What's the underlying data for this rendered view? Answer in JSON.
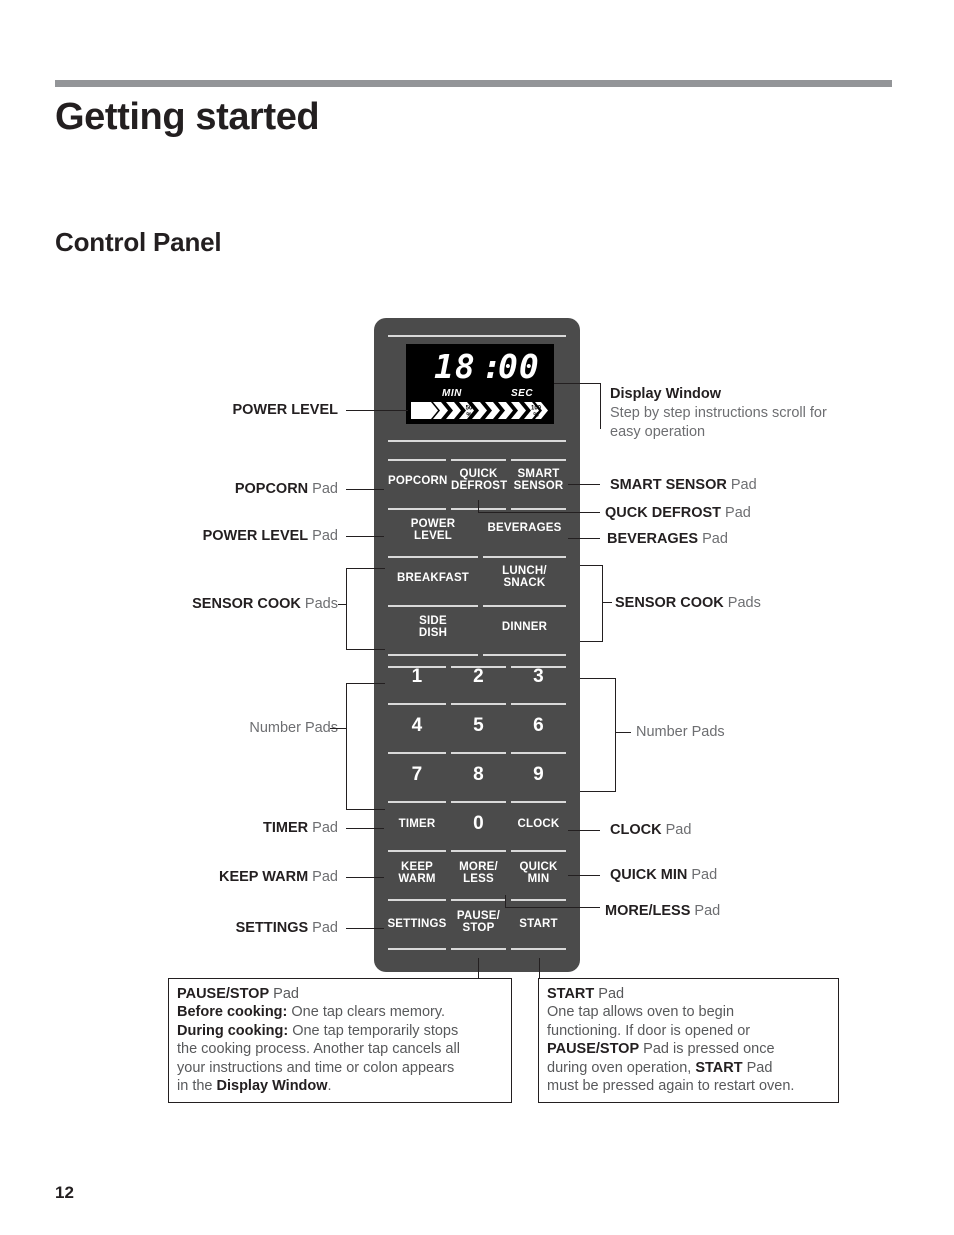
{
  "document": {
    "chapter_title": "Getting started",
    "section_title": "Control Panel",
    "page_number": "12"
  },
  "control_panel": {
    "display": {
      "minutes": "18",
      "colon": ":",
      "seconds": "00",
      "min_unit": "MIN",
      "sec_unit": "SEC",
      "bar_mark_mid": "50",
      "bar_mark_mid_pct": "%",
      "bar_mark_end": "100",
      "bar_mark_end_pct": "%"
    },
    "pads": [
      {
        "id": "popcorn",
        "line1": "POPCORN",
        "line2": ""
      },
      {
        "id": "quick-defrost",
        "line1": "QUICK",
        "line2": "DEFROST"
      },
      {
        "id": "smart-sensor",
        "line1": "SMART",
        "line2": "SENSOR"
      },
      {
        "id": "power-level",
        "line1": "POWER",
        "line2": "LEVEL"
      },
      {
        "id": "beverages",
        "line1": "BEVERAGES",
        "line2": ""
      },
      {
        "id": "breakfast",
        "line1": "BREAKFAST",
        "line2": ""
      },
      {
        "id": "lunch-snack",
        "line1": "LUNCH/",
        "line2": "SNACK"
      },
      {
        "id": "side-dish",
        "line1": "SIDE",
        "line2": "DISH"
      },
      {
        "id": "dinner",
        "line1": "DINNER",
        "line2": ""
      },
      {
        "id": "num-1",
        "line1": "1",
        "line2": ""
      },
      {
        "id": "num-2",
        "line1": "2",
        "line2": ""
      },
      {
        "id": "num-3",
        "line1": "3",
        "line2": ""
      },
      {
        "id": "num-4",
        "line1": "4",
        "line2": ""
      },
      {
        "id": "num-5",
        "line1": "5",
        "line2": ""
      },
      {
        "id": "num-6",
        "line1": "6",
        "line2": ""
      },
      {
        "id": "num-7",
        "line1": "7",
        "line2": ""
      },
      {
        "id": "num-8",
        "line1": "8",
        "line2": ""
      },
      {
        "id": "num-9",
        "line1": "9",
        "line2": ""
      },
      {
        "id": "timer",
        "line1": "TIMER",
        "line2": ""
      },
      {
        "id": "num-0",
        "line1": "0",
        "line2": ""
      },
      {
        "id": "clock",
        "line1": "CLOCK",
        "line2": ""
      },
      {
        "id": "keep-warm",
        "line1": "KEEP",
        "line2": "WARM"
      },
      {
        "id": "more-less",
        "line1": "MORE/",
        "line2": "LESS"
      },
      {
        "id": "quick-min",
        "line1": "QUICK",
        "line2": "MIN"
      },
      {
        "id": "settings",
        "line1": "SETTINGS",
        "line2": ""
      },
      {
        "id": "pause-stop",
        "line1": "PAUSE/",
        "line2": "STOP"
      },
      {
        "id": "start",
        "line1": "START",
        "line2": ""
      }
    ]
  },
  "callouts_left": {
    "power_level_display": {
      "bold": "POWER LEVEL",
      "plain": ""
    },
    "popcorn_pad": {
      "bold": "POPCORN",
      "plain": " Pad"
    },
    "power_level_pad": {
      "bold": "POWER LEVEL",
      "plain": " Pad"
    },
    "sensor_cook_pads": {
      "bold": "SENSOR COOK",
      "plain": " Pads"
    },
    "number_pads": {
      "bold": "",
      "plain": "Number Pads"
    },
    "timer_pad": {
      "bold": "TIMER",
      "plain": " Pad"
    },
    "keep_warm_pad": {
      "bold": "KEEP WARM",
      "plain": " Pad"
    },
    "settings_pad": {
      "bold": "SETTINGS",
      "plain": " Pad"
    }
  },
  "callouts_right": {
    "display_window": {
      "title": "Display Window",
      "body_line1": "Step by step instructions scroll for",
      "body_line2": "easy operation"
    },
    "smart_sensor_pad": {
      "bold": "SMART SENSOR",
      "plain": " Pad"
    },
    "quick_defrost_pad": {
      "bold": "QUCK DEFROST",
      "plain": " Pad"
    },
    "beverages_pad": {
      "bold": "BEVERAGES",
      "plain": " Pad"
    },
    "sensor_cook_pads": {
      "bold": "SENSOR COOK",
      "plain": " Pads"
    },
    "number_pads": {
      "bold": "",
      "plain": "Number Pads"
    },
    "clock_pad": {
      "bold": "CLOCK",
      "plain": " Pad"
    },
    "quick_min_pad": {
      "bold": "QUICK MIN",
      "plain": " Pad"
    },
    "more_less_pad": {
      "bold": "MORE/LESS",
      "plain": " Pad"
    }
  },
  "notes": {
    "pause_stop": {
      "l1_bold": "PAUSE/STOP",
      "l1_plain": " Pad",
      "l2_bold": "Before cooking:",
      "l2_plain": " One tap clears memory.",
      "l3_bold": "During cooking:",
      "l3_plain": " One tap temporarily stops",
      "l4": "the cooking process. Another tap cancels all",
      "l5": "your instructions and time or colon appears",
      "l6_pre": "in the ",
      "l6_bold": "Display Window",
      "l6_post": "."
    },
    "start": {
      "l1_bold": "START",
      "l1_plain": " Pad",
      "l2": "One tap allows oven to begin",
      "l3": "functioning. If door is opened or",
      "l4_bold": "PAUSE/STOP",
      "l4_plain": " Pad is pressed once",
      "l5_pre": "during oven operation, ",
      "l5_bold": "START",
      "l5_post": " Pad",
      "l6": "must be pressed again to restart oven."
    }
  },
  "colors": {
    "panel": "#4b4b4b",
    "display": "#000000",
    "rule": "#939598",
    "text": "#231f20",
    "muted": "#6d6e71"
  }
}
